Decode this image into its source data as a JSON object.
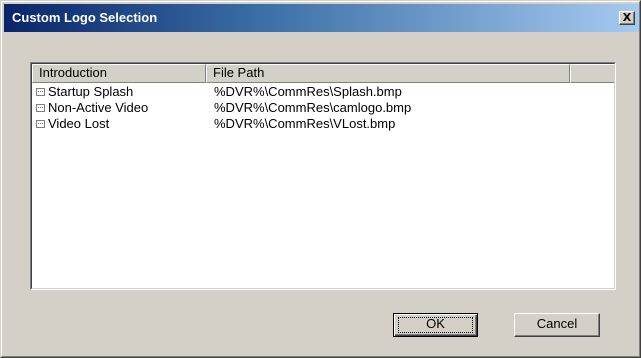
{
  "window": {
    "title": "Custom Logo Selection",
    "close_label": "X"
  },
  "listview": {
    "columns": [
      "Introduction",
      "File Path"
    ],
    "rows": [
      {
        "icon": "file-item-icon",
        "introduction": "Startup Splash",
        "file_path": "%DVR%\\CommRes\\Splash.bmp"
      },
      {
        "icon": "file-item-icon",
        "introduction": "Non-Active Video",
        "file_path": "%DVR%\\CommRes\\camlogo.bmp"
      },
      {
        "icon": "file-item-icon",
        "introduction": "Video Lost",
        "file_path": "%DVR%\\CommRes\\VLost.bmp"
      }
    ]
  },
  "buttons": {
    "ok_label": "OK",
    "cancel_label": "Cancel"
  },
  "colors": {
    "titlebar_start": "#0a246a",
    "titlebar_end": "#a6caf0",
    "dialog_bg": "#d4d0c8"
  }
}
